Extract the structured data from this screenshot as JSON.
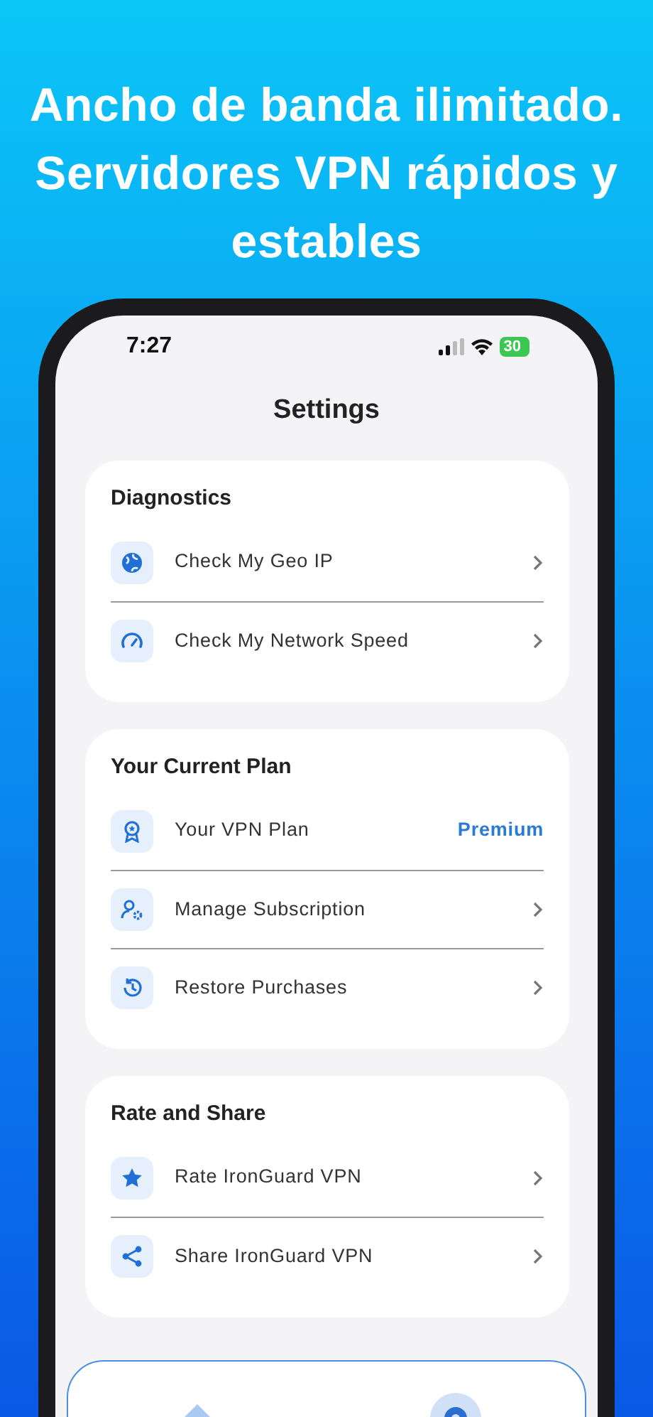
{
  "headline": "Ancho de banda ilimitado. Servidores VPN rápidos y estables",
  "status_bar": {
    "time": "7:27",
    "battery": "30"
  },
  "title": "Settings",
  "sections": [
    {
      "title": "Diagnostics",
      "rows": [
        {
          "kind": "link",
          "label": "Check My Geo IP"
        },
        {
          "kind": "link",
          "label": "Check My Network Speed"
        }
      ]
    },
    {
      "title": "Your Current Plan",
      "rows": [
        {
          "kind": "value",
          "label": "Your VPN Plan",
          "value": "Premium"
        },
        {
          "kind": "link",
          "label": "Manage Subscription"
        },
        {
          "kind": "link",
          "label": "Restore Purchases"
        }
      ]
    },
    {
      "title": "Rate and Share",
      "rows": [
        {
          "kind": "link",
          "label": "Rate IronGuard VPN"
        },
        {
          "kind": "link",
          "label": "Share IronGuard VPN"
        }
      ]
    }
  ],
  "tab_bar": {
    "tabs": [
      {
        "selected": false
      },
      {
        "selected": true
      }
    ]
  }
}
